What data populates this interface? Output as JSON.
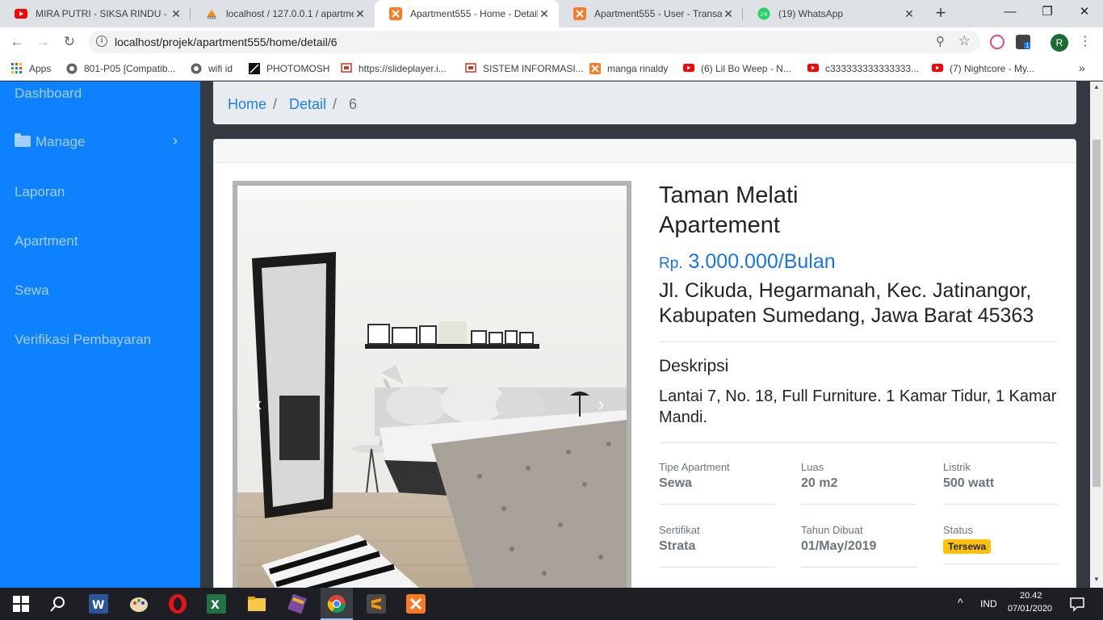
{
  "browser": {
    "tabs": [
      {
        "title": "MIRA PUTRI - SIKSA RINDU - L",
        "icon": "youtube-icon"
      },
      {
        "title": "localhost / 127.0.0.1 / apartme",
        "icon": "phpmyadmin-icon"
      },
      {
        "title": "Apartment555 - Home - Detail",
        "icon": "xampp-icon",
        "active": true
      },
      {
        "title": "Apartment555 - User - Transak",
        "icon": "xampp-icon"
      },
      {
        "title": "(19) WhatsApp",
        "icon": "whatsapp-icon"
      }
    ],
    "whatsapp_badge": "19",
    "url": "localhost/projek/apartment555/home/detail/6",
    "profile_initial": "R",
    "extension_badge": "1",
    "bookmarks": [
      {
        "label": "Apps",
        "icon": "apps-grid-icon"
      },
      {
        "label": "801-P05 [Compatib...",
        "icon": "globe-icon"
      },
      {
        "label": "wifi id",
        "icon": "globe-icon"
      },
      {
        "label": "PHOTOMOSH",
        "icon": "photomosh-icon"
      },
      {
        "label": "https://slideplayer.i...",
        "icon": "slideplayer-icon"
      },
      {
        "label": "SISTEM INFORMASI...",
        "icon": "slideplayer-icon"
      },
      {
        "label": "manga rinaldy",
        "icon": "xampp-icon"
      },
      {
        "label": "(6) Lil Bo Weep - N...",
        "icon": "youtube-icon"
      },
      {
        "label": "c333333333333333...",
        "icon": "youtube-icon"
      },
      {
        "label": "(7) Nightcore - My...",
        "icon": "youtube-icon"
      }
    ]
  },
  "sidebar": {
    "items": [
      {
        "label": "Dashboard"
      },
      {
        "label": "Manage",
        "icon": "folder-icon",
        "has_submenu": true
      },
      {
        "label": "Laporan"
      },
      {
        "label": "Apartment"
      },
      {
        "label": "Sewa"
      },
      {
        "label": "Verifikasi Pembayaran"
      }
    ]
  },
  "breadcrumb": {
    "home": "Home",
    "detail": "Detail",
    "current": "6",
    "separator": "/"
  },
  "detail": {
    "title_line1": "Taman Melati",
    "title_line2": "Apartement",
    "price_prefix": "Rp.",
    "price": "3.000.000/Bulan",
    "address": "Jl. Cikuda, Hegarmanah, Kec. Jatinangor, Kabupaten Sumedang, Jawa Barat 45363",
    "description_heading": "Deskripsi",
    "description": "Lantai 7, No. 18, Full Furniture. 1 Kamar Tidur, 1 Kamar Mandi.",
    "specs": [
      {
        "label": "Tipe Apartment",
        "value": "Sewa"
      },
      {
        "label": "Luas",
        "value": "20 m2"
      },
      {
        "label": "Listrik",
        "value": "500 watt"
      },
      {
        "label": "Sertifikat",
        "value": "Strata"
      },
      {
        "label": "Tahun Dibuat",
        "value": "01/May/2019"
      },
      {
        "label": "Status",
        "value": "Tersewa"
      }
    ]
  },
  "taskbar": {
    "language": "IND",
    "time": "20.42",
    "date": "07/01/2020"
  },
  "colors": {
    "sidebar": "#0d81fe",
    "link": "#1f7fea",
    "badge": "#ffc107",
    "page_background": "#343a40"
  }
}
